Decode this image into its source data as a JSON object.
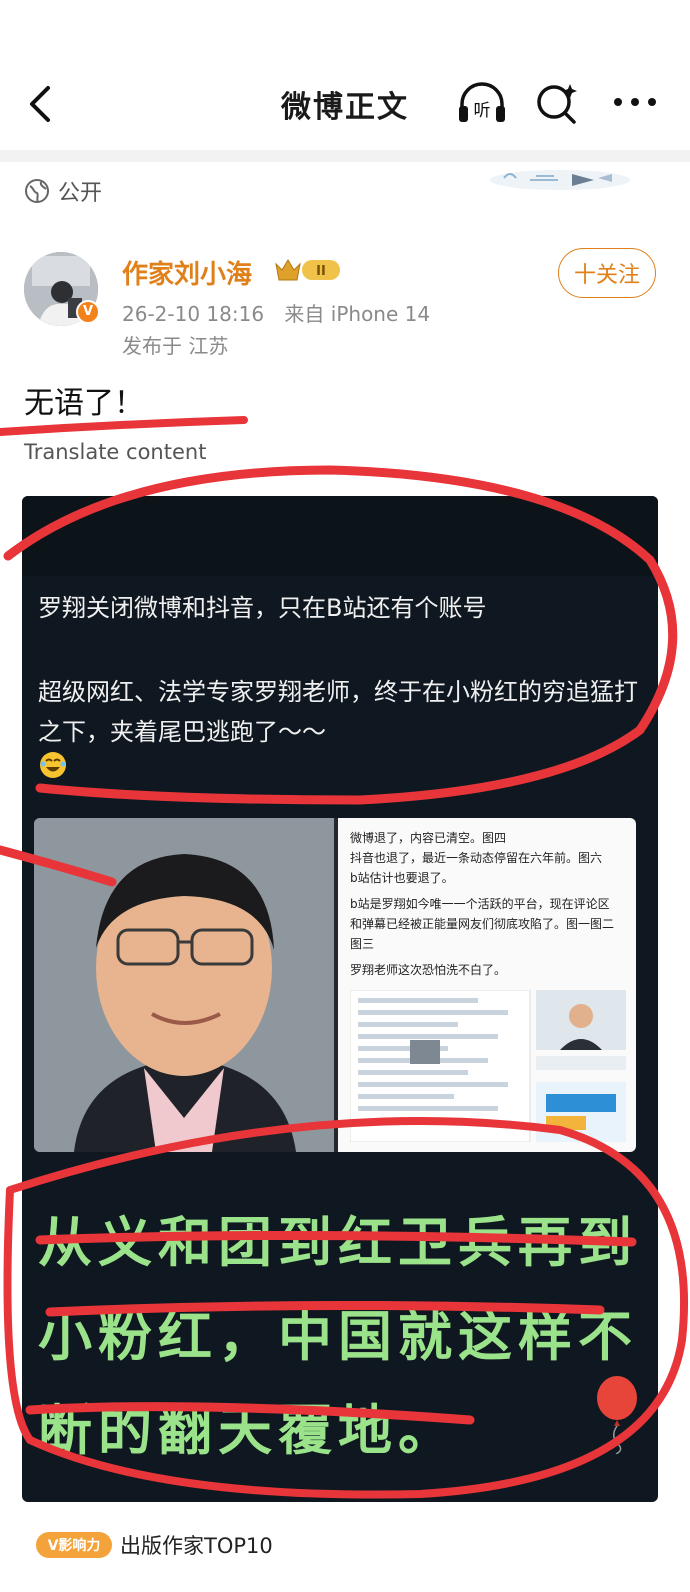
{
  "header": {
    "title": "微博正文",
    "listen_label": "听"
  },
  "visibility": {
    "label": "公开"
  },
  "author": {
    "name": "作家刘小海",
    "level_badge": "II",
    "verified_badge": "V",
    "follow_label": "十关注"
  },
  "meta": {
    "timestamp": "26-2-10 18:16",
    "source": "来自 iPhone 14",
    "location": "发布于 江苏"
  },
  "post": {
    "text": "无语了！",
    "translate_label": "Translate content"
  },
  "embedded_image": {
    "caption_line1": "罗翔关闭微博和抖音，只在B站还有个账号",
    "caption_line2": "超级网红、法学专家罗翔老师，终于在小粉红的穷追猛打之下，夹着尾巴逃跑了～～",
    "screen_text": [
      "微博退了，内容已清空。图四",
      "抖音也退了，最近一条动态停留在六年前。图六",
      "b站估计也要退了。",
      "b站是罗翔如今唯一一个活跃的平台，现在评论区",
      "和弹幕已经被正能量网友们彻底攻陷了。图一图二",
      "图三",
      "罗翔老师这次恐怕洗不白了。"
    ],
    "green_text": "从义和团到红卫兵再到小粉红，中国就这样不断的翻天覆地。"
  },
  "footer": {
    "influence_badge": "V影响力",
    "rank_label": "出版作家TOP10"
  },
  "colors": {
    "accent_orange": "#e0801a",
    "annotation_red": "#e8353a",
    "green_text": "#9be38a",
    "image_bg": "#0f1820"
  }
}
